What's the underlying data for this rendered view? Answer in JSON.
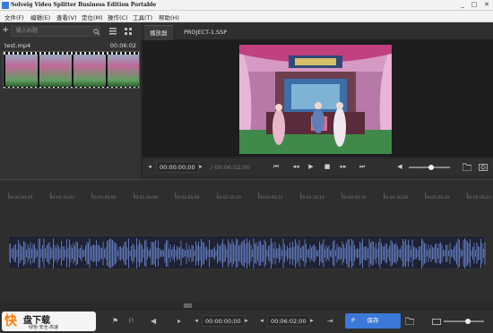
{
  "window": {
    "title": "Solveig Video Splitter Business Edition Portable",
    "controls": [
      "_",
      "□",
      "✕"
    ]
  },
  "menu": {
    "items": [
      "文件(F)",
      "编辑(E)",
      "查看(V)",
      "定位(M)",
      "操作(C)",
      "工具(T)",
      "帮助(H)"
    ]
  },
  "library": {
    "add_label": "+",
    "search_placeholder": "输入标题",
    "file_name": "test.mp4",
    "file_duration": "00:06:02"
  },
  "tabs": [
    {
      "label": "播放器",
      "active": true
    },
    {
      "label": "PROJECT-1.SSP",
      "active": false
    }
  ],
  "player": {
    "current_time": "00:00:00;00",
    "total_time": "/ 00:06:02;00",
    "volume_level": 0.55
  },
  "timeline": {
    "ticks": [
      "00:00:00;00",
      "00:00:30;02",
      "00:01:00;04",
      "00:01:30;06",
      "00:02:00;08",
      "00:02:30;10",
      "00:03:00;12",
      "00:03:30;14",
      "00:04:00;16",
      "00:04:30;18",
      "00:05:00;20",
      "00:05:30;22"
    ]
  },
  "bottom": {
    "start_time": "00:00:00;00",
    "end_time": "00:06:02;00",
    "save_label": "保存",
    "zoom_level": 0.6
  },
  "watermark": {
    "big": "快",
    "brand": "盘下载",
    "tagline": "绿色·安全·高速"
  },
  "colors": {
    "accent": "#3b78d8",
    "waveform": "#6e8bd8"
  }
}
